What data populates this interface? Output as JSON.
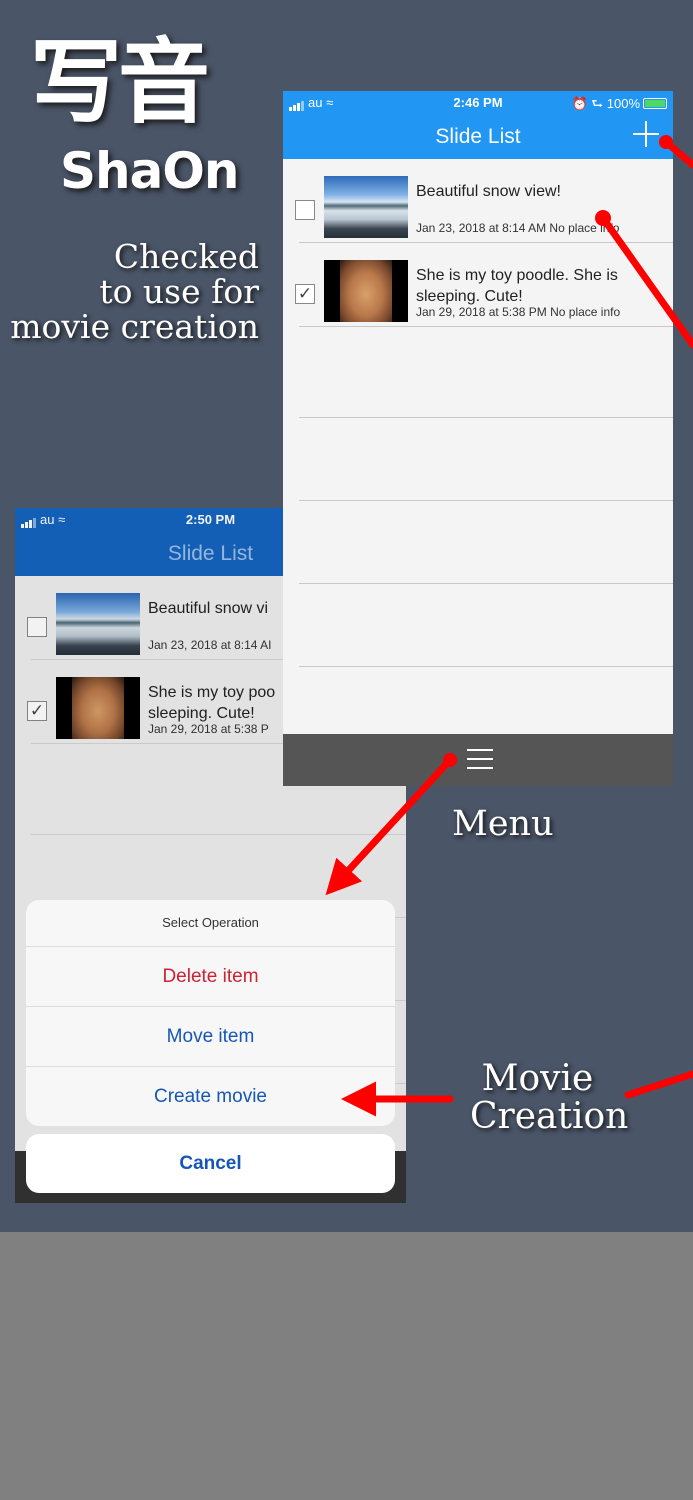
{
  "logo": {
    "japanese": "写音",
    "english": "ShaOn"
  },
  "captions": {
    "checked": [
      "Checked",
      "to use for",
      "movie creation"
    ],
    "menu": "Menu",
    "movie_creation": [
      "Movie",
      "Creation"
    ]
  },
  "front_screen": {
    "status": {
      "carrier": "au",
      "time": "2:46 PM",
      "battery": "100%"
    },
    "title": "Slide List",
    "add_icon": "plus-icon",
    "rows": [
      {
        "title": "Beautiful snow view!",
        "subtitle": "Jan 23, 2018 at 8:14 AM No place info",
        "checked": false
      },
      {
        "title": "She is my toy poodle. She is",
        "title2": "sleeping. Cute!",
        "subtitle": "Jan 29, 2018 at 5:38 PM No place info",
        "checked": true
      }
    ],
    "menu_icon": "hamburger-icon"
  },
  "back_screen": {
    "status": {
      "carrier": "au",
      "time": "2:50 PM"
    },
    "title": "Slide List",
    "rows": [
      {
        "title": "Beautiful snow vi",
        "subtitle": "Jan 23, 2018 at 8:14 AI",
        "checked": false
      },
      {
        "title": "She is my toy poo",
        "title2": "sleeping. Cute!",
        "subtitle": "Jan 29, 2018 at 5:38 P",
        "checked": true
      }
    ]
  },
  "action_sheet": {
    "title": "Select Operation",
    "delete": "Delete item",
    "move": "Move item",
    "create": "Create movie",
    "cancel": "Cancel"
  },
  "colors": {
    "background": "#4a5568",
    "nav_front": "#2196f3",
    "nav_back": "#1565c0",
    "arrow": "#ff0000",
    "destructive": "#cc2233",
    "action": "#1556b8"
  }
}
